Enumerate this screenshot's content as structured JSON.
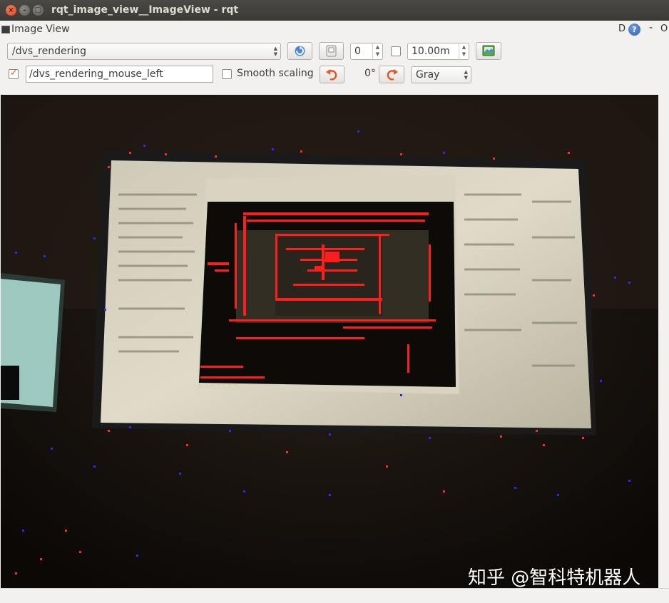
{
  "window": {
    "title": "rqt_image_view__ImageView - rqt",
    "close_glyph": "×",
    "minimize_glyph": "–",
    "maximize_glyph": "□"
  },
  "dock": {
    "title": "Image View",
    "d_label": "D",
    "help_glyph": "?",
    "dash": "-",
    "o_label": "O"
  },
  "toolbar": {
    "topic": "/dvs_rendering",
    "rotation_value": "0",
    "smoothing_enabled": false,
    "max_range": "10.00m",
    "mouse_topic": "/dvs_rendering_mouse_left",
    "mouse_publish_enabled": true,
    "smooth_scaling_label": "Smooth scaling",
    "smooth_scaling_enabled": false,
    "rotation_angle": "0°",
    "color_scheme": "Gray"
  },
  "image": {
    "watermark": "知乎 @智科特机器人"
  },
  "colors": {
    "titlebar": "#3b3a37",
    "accent": "#e15a26",
    "event_positive": "#ff2020",
    "event_negative": "#2020ff"
  }
}
